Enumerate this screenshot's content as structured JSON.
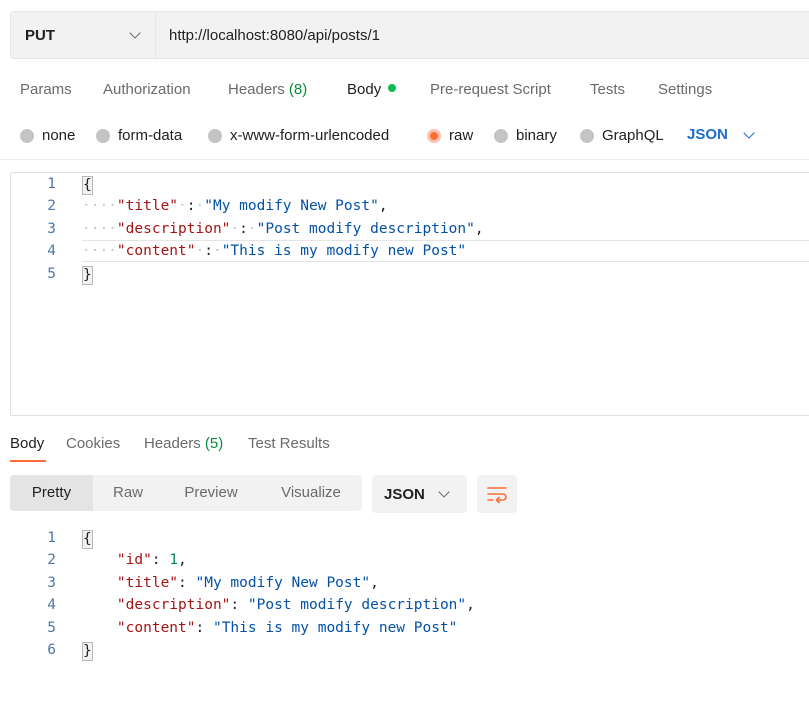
{
  "request": {
    "method": "PUT",
    "url": "http://localhost:8080/api/posts/1"
  },
  "request_tabs": [
    {
      "label": "Params"
    },
    {
      "label": "Authorization"
    },
    {
      "label": "Headers",
      "count": "(8)"
    },
    {
      "label": "Body",
      "active": true
    },
    {
      "label": "Pre-request Script"
    },
    {
      "label": "Tests"
    },
    {
      "label": "Settings"
    }
  ],
  "body_types": {
    "options": [
      "none",
      "form-data",
      "x-www-form-urlencoded",
      "raw",
      "binary",
      "GraphQL"
    ],
    "selected": "raw",
    "language": "JSON"
  },
  "request_body": {
    "line_numbers": [
      "1",
      "2",
      "3",
      "4",
      "5"
    ],
    "open_brace": "{",
    "close_brace": "}",
    "fields": [
      {
        "key": "\"title\"",
        "value": "\"My modify New Post\"",
        "sep": ","
      },
      {
        "key": "\"description\"",
        "value": "\"Post modify description\"",
        "sep": ","
      },
      {
        "key": "\"content\"",
        "value": "\"This is my modify new Post\"",
        "sep": ""
      }
    ]
  },
  "response_tabs": [
    {
      "label": "Body",
      "active": true
    },
    {
      "label": "Cookies"
    },
    {
      "label": "Headers",
      "count": "(5)"
    },
    {
      "label": "Test Results"
    }
  ],
  "view_modes": {
    "options": [
      "Pretty",
      "Raw",
      "Preview",
      "Visualize"
    ],
    "selected": "Pretty",
    "format": "JSON"
  },
  "response_body": {
    "line_numbers": [
      "1",
      "2",
      "3",
      "4",
      "5",
      "6"
    ],
    "open_brace": "{",
    "close_brace": "}",
    "id_key": "\"id\"",
    "id_value": "1",
    "fields": [
      {
        "key": "\"title\"",
        "value": "\"My modify New Post\"",
        "sep": ","
      },
      {
        "key": "\"description\"",
        "value": "\"Post modify description\"",
        "sep": ","
      },
      {
        "key": "\"content\"",
        "value": "\"This is my modify new Post\"",
        "sep": ""
      }
    ]
  },
  "colors": {
    "accent": "#ff6c37",
    "active_dot": "#0cbb52",
    "link_blue": "#1d6bce",
    "json_key": "#a31515",
    "json_string": "#0451a5",
    "json_number": "#098658"
  }
}
